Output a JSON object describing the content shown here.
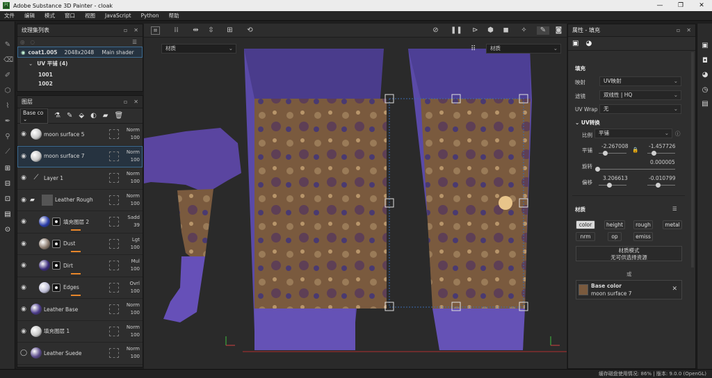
{
  "window": {
    "title": "Adobe Substance 3D Painter - cloak",
    "app_icon": "Pt",
    "controls": [
      "—",
      "❐",
      "✕"
    ]
  },
  "menu": [
    "文件",
    "编辑",
    "模式",
    "窗口",
    "视图",
    "JavaScript",
    "Python",
    "帮助"
  ],
  "texture_set_list": {
    "title": "纹理集列表",
    "set_name": "coat1.005",
    "resolution": "2048x2048",
    "shader": "Main shader",
    "uv_group": "UV 平铺 (4)",
    "tiles": [
      "1001",
      "1002"
    ]
  },
  "layers": {
    "title": "图层",
    "channel_select": "Base co",
    "items": [
      {
        "name": "moon surface 5",
        "blend": "Norm",
        "opacity": "100",
        "thumb": "#c8c8c8",
        "mask": false,
        "folder": false,
        "eye": true
      },
      {
        "name": "moon surface 7",
        "blend": "Norm",
        "opacity": "100",
        "thumb": "#c8c8c8",
        "mask": false,
        "folder": false,
        "eye": true,
        "selected": true
      },
      {
        "name": "Layer 1",
        "blend": "Norm",
        "opacity": "100",
        "thumb": "brush",
        "mask": false,
        "folder": false,
        "eye": true
      },
      {
        "name": "Leather Rough",
        "blend": "Norm",
        "opacity": "100",
        "thumb": "#666",
        "mask": false,
        "folder": true,
        "eye": true
      },
      {
        "name": "填充图层 2",
        "blend": "Sadd",
        "opacity": "39",
        "thumb": "#2a3ca8",
        "mask": true,
        "folder": false,
        "eye": true
      },
      {
        "name": "Dust",
        "blend": "Lgt",
        "opacity": "100",
        "thumb": "#8a7a6e",
        "mask": true,
        "folder": false,
        "eye": true
      },
      {
        "name": "Dirt",
        "blend": "Mul",
        "opacity": "100",
        "thumb": "#3a2a7a",
        "mask": true,
        "folder": false,
        "eye": true
      },
      {
        "name": "Edges",
        "blend": "Ovrl",
        "opacity": "100",
        "thumb": "#bfbfd8",
        "mask": true,
        "folder": false,
        "eye": true
      },
      {
        "name": "Leather Base",
        "blend": "Norm",
        "opacity": "100",
        "thumb": "#4a3a8a",
        "mask": false,
        "folder": false,
        "eye": true
      },
      {
        "name": "填充图层 1",
        "blend": "Norm",
        "opacity": "100",
        "thumb": "#c8c8c8",
        "mask": false,
        "folder": false,
        "eye": true
      },
      {
        "name": "Leather Suede",
        "blend": "Norm",
        "opacity": "100",
        "thumb": "#5a4a8a",
        "mask": false,
        "folder": false,
        "eye": false
      }
    ]
  },
  "viewport": {
    "material_left": "材质",
    "material_right": "材质"
  },
  "properties": {
    "title": "属性 - 填充",
    "fill_section": "填充",
    "mapping_label": "映射",
    "mapping_value": "UV映射",
    "filter_label": "滤镜",
    "filter_value": "双线性 | HQ",
    "uvwrap_label": "UV Wrap",
    "uvwrap_value": "无",
    "uv_transform": "UV转换",
    "scale_label": "比例",
    "scale_value": "平铺",
    "tile_label": "平铺",
    "tile_x": "-2.267008",
    "tile_y": "-1.457726",
    "rotation_label": "旋转",
    "rotation_value": "0.000005",
    "offset_label": "偏移",
    "offset_x": "3.206613",
    "offset_y": "-0.010799",
    "material_section": "材质",
    "channels": [
      "color",
      "height",
      "rough",
      "metal",
      "nrm",
      "op",
      "emiss"
    ],
    "material_mode_title": "材质模式",
    "material_mode_sub": "无可供选择资源",
    "or_label": "或",
    "base_color_title": "Base color",
    "base_color_source": "moon surface 7"
  },
  "status": "缓存磁盘使用情况: 86% | 版本: 9.0.0 (OpenGL)",
  "colors": {
    "accent": "#3d6c92",
    "purple": "#6a4fb0",
    "orange": "#e8862a"
  }
}
